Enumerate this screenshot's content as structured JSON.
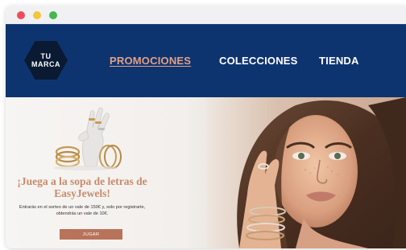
{
  "window": {
    "controls": [
      "close",
      "minimize",
      "maximize"
    ]
  },
  "header": {
    "logo": {
      "line1": "TU",
      "line2": "MARCA"
    },
    "nav": [
      {
        "label": "PROMOCIONES",
        "active": true
      },
      {
        "label": "COLECCIONES",
        "active": false
      },
      {
        "label": "TIENDA",
        "active": false
      }
    ]
  },
  "hero": {
    "title": "¡Juega a la sopa de letras de EasyJewels!",
    "text": "Entrarás en el sorteo de un vale de 150€ y, solo por registrarte, obtendrás un vale de 10€.",
    "cta_label": "JUGAR",
    "images": [
      "jewelry-on-hand-sculpture",
      "woman-wearing-bracelets-and-rings"
    ]
  },
  "colors": {
    "header_bg": "#0e3470",
    "accent": "#c98a6a",
    "button": "#b8735a",
    "active_nav": "#e3a083",
    "window_close": "#ee4e5a",
    "window_minimize": "#f5c53a",
    "window_maximize": "#45b94d"
  }
}
